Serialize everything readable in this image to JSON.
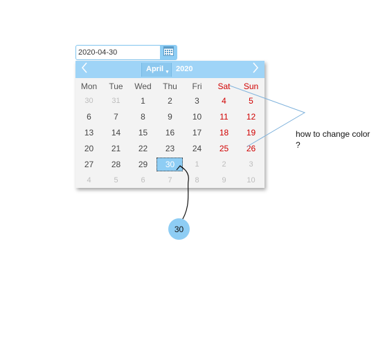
{
  "date_input": {
    "value": "2020-04-30"
  },
  "header": {
    "month": "April",
    "year": "2020"
  },
  "weekdays": [
    "Mon",
    "Tue",
    "Wed",
    "Thu",
    "Fri",
    "Sat",
    "Sun"
  ],
  "weeks": [
    [
      "30",
      "31",
      "1",
      "2",
      "3",
      "4",
      "5"
    ],
    [
      "6",
      "7",
      "8",
      "9",
      "10",
      "11",
      "12"
    ],
    [
      "13",
      "14",
      "15",
      "16",
      "17",
      "18",
      "19"
    ],
    [
      "20",
      "21",
      "22",
      "23",
      "24",
      "25",
      "26"
    ],
    [
      "27",
      "28",
      "29",
      "30",
      "1",
      "2",
      "3"
    ],
    [
      "4",
      "5",
      "6",
      "7",
      "8",
      "9",
      "10"
    ]
  ],
  "annotation": {
    "question": "how to change color ?",
    "bubble_value": "30"
  },
  "colors": {
    "accent": "#8ecdf4",
    "weekend": "#d00000",
    "muted": "#bdbdbd"
  }
}
